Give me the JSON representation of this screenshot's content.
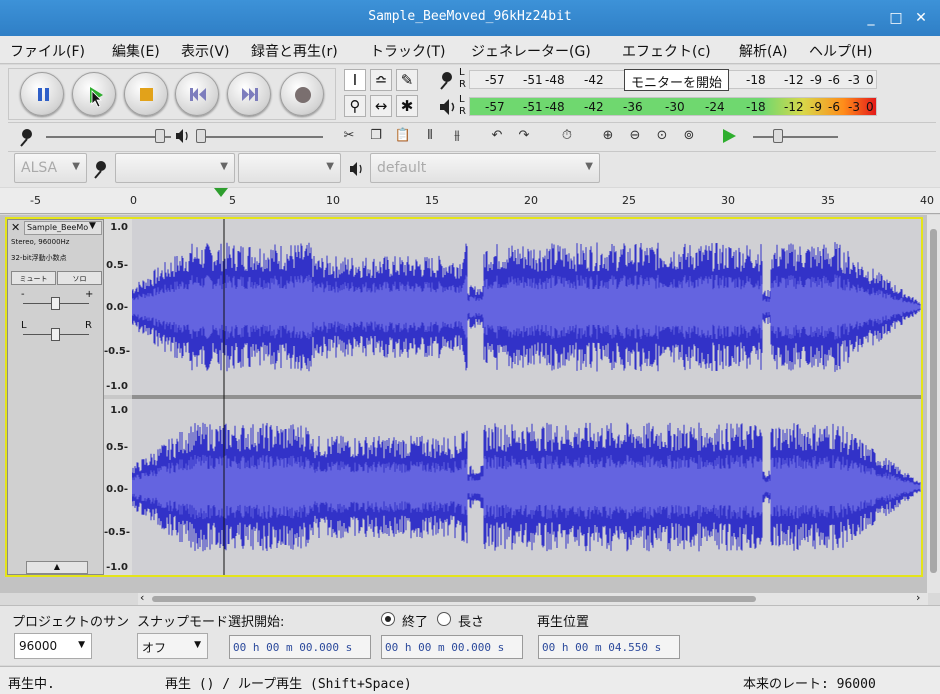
{
  "window": {
    "title": "Sample_BeeMoved_96kHz24bit",
    "minimize": "_",
    "maximize": "□",
    "close": "✕"
  },
  "menu": [
    "ファイル(F)",
    "編集(E)",
    "表示(V)",
    "録音と再生(r)",
    "トラック(T)",
    "ジェネレーター(G)",
    "エフェクト(c)",
    "解析(A)",
    "ヘルプ(H)"
  ],
  "transport": {
    "pause": "pause-icon",
    "play": "play-icon",
    "stop": "stop-icon",
    "skip_start": "skip-start-icon",
    "skip_end": "skip-end-icon",
    "record": "record-icon"
  },
  "tools": {
    "row1": [
      "I",
      "≏",
      "✎"
    ],
    "row2": [
      "⚲",
      "↔",
      "✱"
    ]
  },
  "meters": {
    "record": {
      "L": "L",
      "R": "R",
      "ticks": [
        "-57",
        "-51",
        "-48",
        "-42",
        "-18",
        "-12",
        "-9",
        "-6",
        "-3",
        "0"
      ],
      "tooltip": "モニターを開始"
    },
    "play": {
      "L": "L",
      "R": "R",
      "ticks": [
        "-57",
        "-51",
        "-48",
        "-42",
        "-36",
        "-30",
        "-24",
        "-18",
        "-12",
        "-9",
        "-6",
        "-3",
        "0"
      ]
    }
  },
  "device": {
    "host": "ALSA",
    "input": "",
    "channels": "",
    "output": "default"
  },
  "ruler": {
    "ticks": [
      "-5",
      "0",
      "5",
      "10",
      "15",
      "20",
      "25",
      "30",
      "35",
      "40"
    ]
  },
  "track": {
    "name": "Sample_BeeMo",
    "info1": "Stereo, 96000Hz",
    "info2": "32-bit浮動小数点",
    "mute": "ミュート",
    "solo": "ソロ",
    "gain_minus": "-",
    "gain_plus": "+",
    "pan_left": "L",
    "pan_right": "R",
    "collapse": "▲",
    "ylabels": [
      "1.0",
      "0.5-",
      "0.0-",
      "-0.5-",
      "-1.0"
    ]
  },
  "bottom": {
    "rate_label": "プロジェクトのサン",
    "rate_value": "96000",
    "snap_label": "スナップモード",
    "snap_value": "オフ",
    "sel_start_label": "選択開始:",
    "end_label": "終了",
    "length_label": "長さ",
    "pos_label": "再生位置",
    "sel_start_value": "00 h 00 m 00.000 s",
    "sel_end_value": "00 h 00 m 00.000 s",
    "pos_value": "00 h 00 m 04.550 s"
  },
  "status": {
    "state": "再生中.",
    "hint": "再生 () / ループ再生 (Shift+Space)",
    "rate": "本来のレート: 96000"
  }
}
